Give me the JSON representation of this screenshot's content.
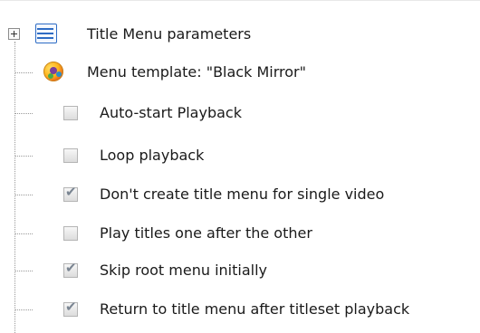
{
  "tree": {
    "root": {
      "label": "Title Menu parameters",
      "expander_icon": "plus-expander-icon",
      "icon": "list-icon",
      "expanded": false
    },
    "template": {
      "label": "Menu template: \"Black Mirror\"",
      "icon": "template-palette-icon"
    },
    "options": [
      {
        "label": "Auto-start Playback",
        "checked": false
      },
      {
        "label": "Loop playback",
        "checked": false
      },
      {
        "label": "Don't create title menu for single video",
        "checked": true
      },
      {
        "label": "Play titles one after the other",
        "checked": false
      },
      {
        "label": "Skip root menu initially",
        "checked": true
      },
      {
        "label": "Return to title menu after titleset playback",
        "checked": true
      }
    ]
  },
  "colors": {
    "tree_line": "#9a9a9a",
    "checkmark": "#7a8592",
    "icon_blue": "#2e6cc4"
  }
}
